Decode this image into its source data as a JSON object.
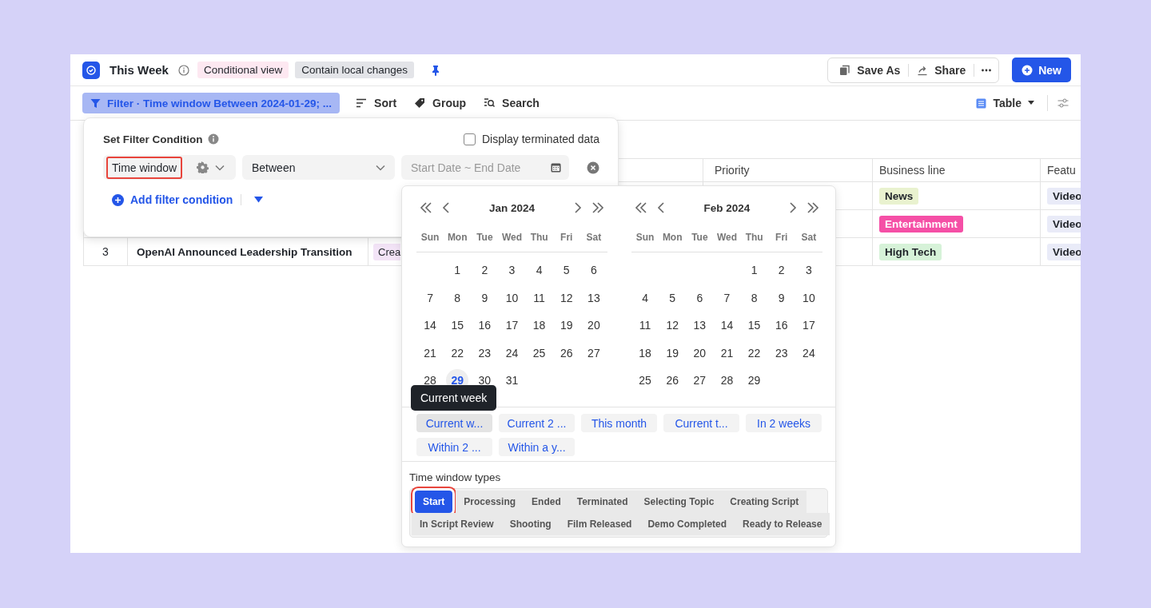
{
  "view": {
    "title": "This Week",
    "badges": [
      {
        "label": "Conditional view",
        "color": "#fde8f1"
      },
      {
        "label": "Contain local changes",
        "color": "#e3e4e8"
      }
    ]
  },
  "actions": {
    "group": [
      {
        "label": "Save As",
        "kind": "copy"
      },
      {
        "label": "Share",
        "kind": "share"
      }
    ],
    "new_button": "New"
  },
  "toolbar": {
    "filter": "Filter · Time window Between 2024-01-29; ...",
    "items": [
      {
        "label": "Sort",
        "kind": "sort"
      },
      {
        "label": "Group",
        "kind": "tag"
      },
      {
        "label": "Search",
        "kind": "search"
      }
    ],
    "view_switch": {
      "label": "Table",
      "expanded": false
    }
  },
  "table": {
    "columns": [
      "Priority",
      "Business line",
      "Featu"
    ],
    "rows": [
      {
        "business_line": {
          "label": "News",
          "color": "#e9f2cf"
        },
        "feature": "Video"
      },
      {
        "business_line": {
          "label": "Entertainment",
          "color": "#f54fa6"
        },
        "feature": "Video"
      },
      {
        "number": "3",
        "title": "OpenAI Announced Leadership Transition",
        "stage": {
          "label": "Crea",
          "color": "#f3e4f7"
        },
        "business_line": {
          "label": "High Tech",
          "color": "#d6f2d8"
        },
        "feature": "Video"
      }
    ]
  },
  "filter_panel": {
    "title": "Set Filter Condition",
    "show_terminated": {
      "label": "Display terminated data",
      "checked": false
    },
    "condition": {
      "field": "Time window",
      "field_outlined": true,
      "operator": "Between",
      "value_placeholder": "Start Date ~ End Date"
    },
    "add_label": "Add filter condition"
  },
  "date_picker": {
    "months": [
      {
        "title": "Jan 2024",
        "weekdays": [
          "Sun",
          "Mon",
          "Tue",
          "Wed",
          "Thu",
          "Fri",
          "Sat"
        ],
        "weeks": [
          [
            {
              "n": "1",
              "today": false
            },
            {
              "n": "2",
              "today": false
            },
            {
              "n": "3",
              "today": false
            },
            {
              "n": "4",
              "today": false
            },
            {
              "n": "5",
              "today": false
            },
            {
              "n": "6",
              "today": false
            }
          ],
          [
            {
              "n": "7",
              "today": false
            },
            {
              "n": "8",
              "today": false
            },
            {
              "n": "9",
              "today": false
            },
            {
              "n": "10",
              "today": false
            },
            {
              "n": "11",
              "today": false
            },
            {
              "n": "12",
              "today": false
            },
            {
              "n": "13",
              "today": false
            }
          ],
          [
            {
              "n": "14",
              "today": false
            },
            {
              "n": "15",
              "today": false
            },
            {
              "n": "16",
              "today": false
            },
            {
              "n": "17",
              "today": false
            },
            {
              "n": "18",
              "today": false
            },
            {
              "n": "19",
              "today": false
            },
            {
              "n": "20",
              "today": false
            }
          ],
          [
            {
              "n": "21",
              "today": false
            },
            {
              "n": "22",
              "today": false
            },
            {
              "n": "23",
              "today": false
            },
            {
              "n": "24",
              "today": false
            },
            {
              "n": "25",
              "today": false
            },
            {
              "n": "26",
              "today": false
            },
            {
              "n": "27",
              "today": false
            }
          ],
          [
            {
              "n": "28",
              "today": false
            },
            {
              "n": "29",
              "today": true
            },
            {
              "n": "30",
              "today": false
            },
            {
              "n": "31",
              "today": false
            }
          ]
        ]
      },
      {
        "title": "Feb 2024",
        "weekdays": [
          "Sun",
          "Mon",
          "Tue",
          "Wed",
          "Thu",
          "Fri",
          "Sat"
        ],
        "weeks": [
          [
            {
              "n": "1",
              "today": false
            },
            {
              "n": "2",
              "today": false
            },
            {
              "n": "3",
              "today": false
            }
          ],
          [
            {
              "n": "4",
              "today": false
            },
            {
              "n": "5",
              "today": false
            },
            {
              "n": "6",
              "today": false
            },
            {
              "n": "7",
              "today": false
            },
            {
              "n": "8",
              "today": false
            },
            {
              "n": "9",
              "today": false
            },
            {
              "n": "10",
              "today": false
            }
          ],
          [
            {
              "n": "11",
              "today": false
            },
            {
              "n": "12",
              "today": false
            },
            {
              "n": "13",
              "today": false
            },
            {
              "n": "14",
              "today": false
            },
            {
              "n": "15",
              "today": false
            },
            {
              "n": "16",
              "today": false
            },
            {
              "n": "17",
              "today": false
            }
          ],
          [
            {
              "n": "18",
              "today": false
            },
            {
              "n": "19",
              "today": false
            },
            {
              "n": "20",
              "today": false
            },
            {
              "n": "21",
              "today": false
            },
            {
              "n": "22",
              "today": false
            },
            {
              "n": "23",
              "today": false
            },
            {
              "n": "24",
              "today": false
            }
          ],
          [
            {
              "n": "25",
              "today": false
            },
            {
              "n": "26",
              "today": false
            },
            {
              "n": "27",
              "today": false
            },
            {
              "n": "28",
              "today": false
            },
            {
              "n": "29",
              "today": false
            }
          ]
        ]
      }
    ],
    "tooltip": "Current week",
    "shortcuts": [
      {
        "label": "Current w...",
        "selected": true
      },
      {
        "label": "Current 2 ...",
        "selected": false
      },
      {
        "label": "This month",
        "selected": false
      },
      {
        "label": "Current t...",
        "selected": false
      },
      {
        "label": "In 2 weeks",
        "selected": false
      },
      {
        "label": "Within 2 ...",
        "selected": false
      },
      {
        "label": "Within a y...",
        "selected": false
      }
    ],
    "types_title": "Time window types",
    "type_rows": [
      [
        {
          "label": "Start",
          "selected": true,
          "outlined": true
        },
        {
          "label": "Processing",
          "selected": false,
          "outlined": false
        },
        {
          "label": "Ended",
          "selected": false,
          "outlined": false
        },
        {
          "label": "Terminated",
          "selected": false,
          "outlined": false
        },
        {
          "label": "Selecting Topic",
          "selected": false,
          "outlined": false
        },
        {
          "label": "Creating Script",
          "selected": false,
          "outlined": false
        }
      ],
      [
        {
          "label": "In Script Review",
          "selected": false,
          "outlined": false
        },
        {
          "label": "Shooting",
          "selected": false,
          "outlined": false
        },
        {
          "label": "Film Released",
          "selected": false,
          "outlined": false
        },
        {
          "label": "Demo Completed",
          "selected": false,
          "outlined": false
        },
        {
          "label": "Ready to Release",
          "selected": false,
          "outlined": false
        }
      ]
    ]
  }
}
